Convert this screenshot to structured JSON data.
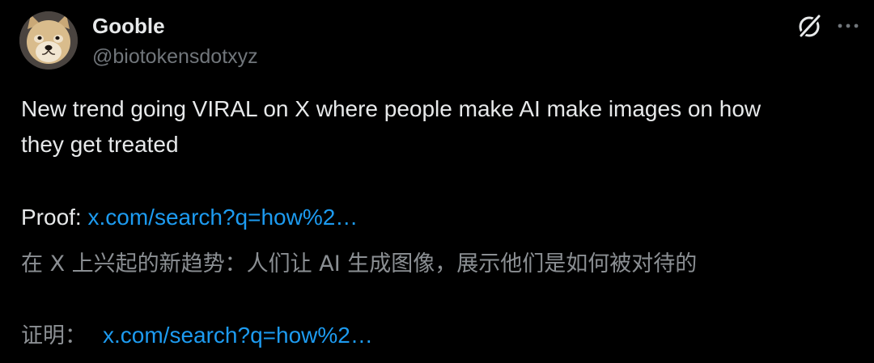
{
  "author": {
    "display_name": "Gooble",
    "handle": "@biotokensdotxyz",
    "avatar_icon": "doge-avatar"
  },
  "header_actions": {
    "grok_icon": "grok-icon",
    "more_icon": "more-icon"
  },
  "post": {
    "line1": "New trend going VIRAL on X where people make AI make images on how",
    "line2": "they get treated",
    "proof_label": "Proof: ",
    "proof_link": "x.com/search?q=how%2…"
  },
  "translation": {
    "text": "在 X 上兴起的新趋势：人们让 AI 生成图像，展示他们是如何被对待的",
    "proof_label": "证明：",
    "proof_link": "x.com/search?q=how%2…"
  },
  "colors": {
    "background": "#000000",
    "text_primary": "#e7e9ea",
    "text_secondary": "#71767b",
    "link": "#1d9bf0"
  }
}
